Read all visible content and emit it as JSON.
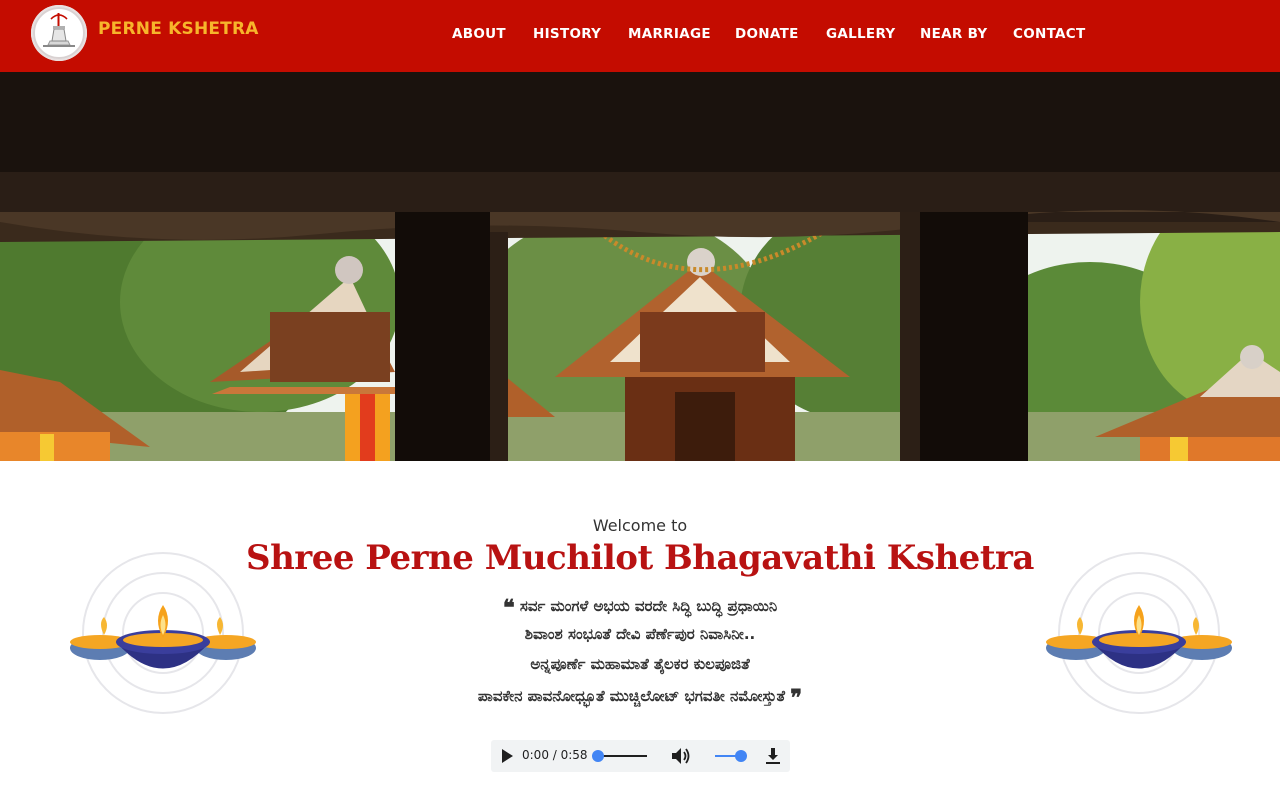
{
  "header": {
    "brand": "PERNE KSHETRA",
    "nav": [
      "ABOUT",
      "HISTORY",
      "MARRIAGE",
      "DONATE",
      "GALLERY",
      "NEAR BY",
      "CONTACT"
    ]
  },
  "intro": {
    "welcome": "Welcome to",
    "title": "Shree Perne Muchilot Bhagavathi Kshetra",
    "verse": [
      "ಸರ್ವ ಮಂಗಳೆ ಅಭಯ ವರದೇ ಸಿದ್ಧಿ ಬುದ್ಧಿ ಪ್ರಧಾಯಿನಿ",
      "ಶಿವಾಂಶ ಸಂಭೂತೆ ದೇವಿ ಪೆರ್ಣೆಪುರ ನಿವಾಸಿನೀ..",
      "ಅನ್ನಪೂರ್ಣೆ ಮಹಾಮಾತೆ ತೈಲಕರ ಕುಲಪೂಜಿತೆ",
      "ಪಾವಕೇನ ಪಾವನೋಧ್ಭೂತೆ ಮುಚ್ಚಿಲೋಟ್ ಭಗವತೀ ನಮೋಸ್ತುತೆ"
    ],
    "quote_open": "❝",
    "quote_close": "❞"
  },
  "audio": {
    "time": "0:00 / 0:58",
    "progress": 0,
    "volume": 1.0
  },
  "icons": {
    "play": "play-icon",
    "volume": "volume-icon",
    "download": "download-icon",
    "lamp": "diya-lamp-icon",
    "logo": "temple-logo-icon"
  },
  "colors": {
    "nav_bg": "#c40c00",
    "brand": "#f7b52b",
    "title": "#b81212",
    "audio_accent": "#4285f4"
  }
}
